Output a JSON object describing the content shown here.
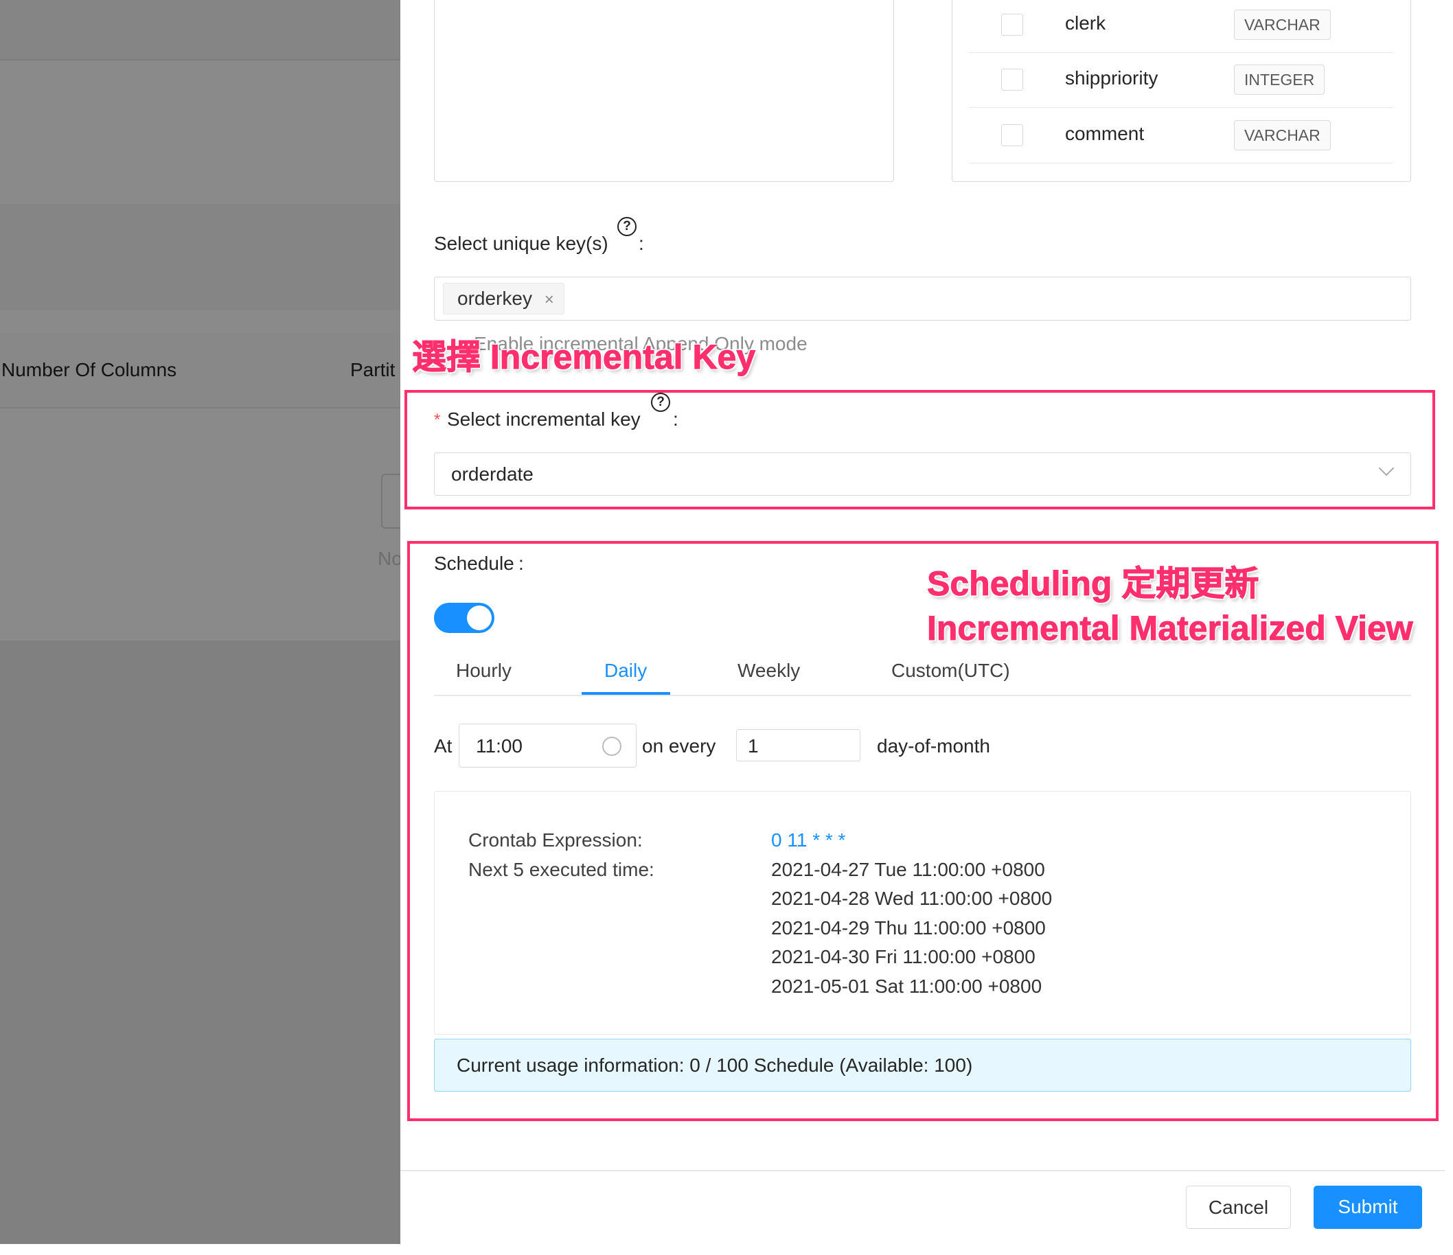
{
  "background": {
    "table_header": [
      "Number Of Columns",
      "Partit"
    ],
    "empty_text": "No"
  },
  "columns": [
    {
      "name": "clerk",
      "type": "VARCHAR",
      "checked": false
    },
    {
      "name": "shippriority",
      "type": "INTEGER",
      "checked": false
    },
    {
      "name": "comment",
      "type": "VARCHAR",
      "checked": false
    }
  ],
  "unique_keys": {
    "label": "Select unique key(s)",
    "help_icon": "question-circle-icon",
    "colon": ":",
    "tags": [
      "orderkey"
    ],
    "remove": "×",
    "hint": "Enable incremental Append Only mode"
  },
  "incremental_key": {
    "required_mark": "*",
    "label": "Select incremental key",
    "help_icon": "question-circle-icon",
    "colon": ":",
    "value": "orderdate"
  },
  "schedule": {
    "label": "Schedule",
    "colon": ":",
    "enabled": true,
    "tabs": [
      {
        "label": "Hourly"
      },
      {
        "label": "Daily",
        "active": true
      },
      {
        "label": "Weekly"
      },
      {
        "label": "Custom(UTC)"
      }
    ],
    "at_label": "At",
    "time": "11:00",
    "on_every_label": "on every",
    "every_value": "1",
    "unit_label": "day-of-month",
    "crontab_label": "Crontab Expression:",
    "crontab_value": "0 11 * * *",
    "next_label": "Next 5 executed time:",
    "next_times": [
      "2021-04-27 Tue 11:00:00 +0800",
      "2021-04-28 Wed 11:00:00 +0800",
      "2021-04-29 Thu 11:00:00 +0800",
      "2021-04-30 Fri 11:00:00 +0800",
      "2021-05-01 Sat 11:00:00 +0800"
    ],
    "usage": "Current usage information: 0 / 100 Schedule (Available: 100)"
  },
  "annotations": {
    "incremental": "選擇 Incremental Key",
    "scheduling": "Scheduling 定期更新",
    "imv": "Incremental Materialized View"
  },
  "footer": {
    "cancel": "Cancel",
    "submit": "Submit"
  },
  "colors": {
    "primary": "#1890ff",
    "annotation": "#ff2f6e",
    "mask": "#8a8a8a",
    "alert_bg": "#e6f7ff"
  }
}
